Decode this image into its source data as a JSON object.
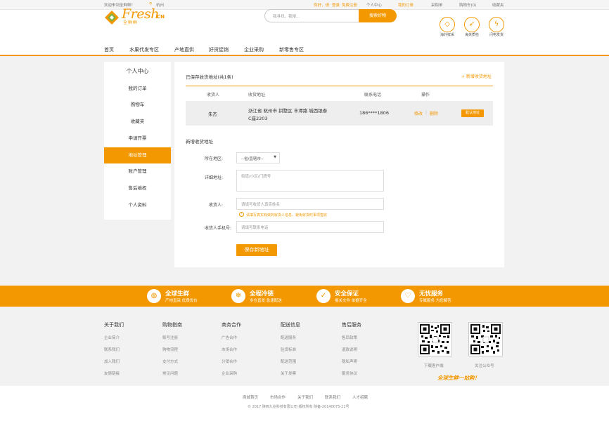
{
  "topbar": {
    "welcome": "欢迎来到全鲜鲜！",
    "city": "杭州",
    "greeting": "你好，请",
    "login": "登录",
    "register": "免费注册",
    "links": [
      "个人中心",
      "我的订单",
      "采购单",
      "购物车(0)",
      "收藏夹"
    ]
  },
  "header": {
    "logo_text": "Fresh",
    "logo_cn": "CN",
    "logo_sub": "全鲜鲜",
    "search_placeholder": "我寻找，我搜...",
    "search_button": "搜索好物",
    "icons": [
      {
        "label": "海外鲜采",
        "icon": "diamond-icon"
      },
      {
        "label": "海关质检",
        "icon": "rocket-icon"
      },
      {
        "label": "闪电发货",
        "icon": "lightning-icon"
      }
    ]
  },
  "nav": [
    "首页",
    "水果代发专区",
    "产地直供",
    "好货促销",
    "企业采购",
    "新零售专区"
  ],
  "sidebar": {
    "title": "个人中心",
    "items": [
      "我的订单",
      "购物车",
      "收藏夹",
      "申请开票",
      "地址管理",
      "账户管理",
      "售后维权",
      "个人资料"
    ],
    "active_index": 4
  },
  "address": {
    "saved_title": "已保存收货地址(共1条)",
    "add_link": "+ 新增收货地址",
    "columns": [
      "收货人",
      "收货地址",
      "联系电话",
      "操作"
    ],
    "rows": [
      {
        "name": "朱杰",
        "address_line1": "浙江省 杭州市 拱墅区 丰潭路 城西银泰",
        "address_line2": "C座2203",
        "phone": "186****1806",
        "edit": "修改",
        "delete": "删除",
        "default": "默认地址"
      }
    ]
  },
  "form": {
    "title": "新增收货地址",
    "region_label": "所在地区:",
    "region_value": "--省/直辖市--",
    "detail_label": "详细地址:",
    "detail_placeholder": "街道/小区/门牌号",
    "name_label": "收货人:",
    "name_placeholder": "请填写收货人真实姓名",
    "name_hint": "请填写真实有效的收货人信息，避免收货时事项签收",
    "phone_label": "收货人手机号:",
    "phone_placeholder": "请填写联系电话",
    "save_button": "保存新地址"
  },
  "banner": [
    {
      "title": "全球生鲜",
      "sub": "产地直采  优质优价",
      "icon": "globe-icon"
    },
    {
      "title": "全程冷链",
      "sub": "多仓直发  急速配送",
      "icon": "snowflake-icon"
    },
    {
      "title": "安全保证",
      "sub": "报关文件  单据齐全",
      "icon": "shield-check-icon"
    },
    {
      "title": "无忧服务",
      "sub": "专属服务  为您解答",
      "icon": "handshake-icon"
    }
  ],
  "footer": {
    "columns": [
      {
        "title": "关于我们",
        "items": [
          "企业简介",
          "联系我们",
          "加入我们",
          "友情链接"
        ]
      },
      {
        "title": "购物指南",
        "items": [
          "账号注册",
          "购物流程",
          "支付方式",
          "常见问题"
        ]
      },
      {
        "title": "商务合作",
        "items": [
          "广告合作",
          "市场合作",
          "分销合作",
          "企业采购"
        ]
      },
      {
        "title": "配送信息",
        "items": [
          "配送服务",
          "验货标准",
          "配送范围",
          "关于发票"
        ]
      },
      {
        "title": "售后服务",
        "items": [
          "售后政策",
          "退款说明",
          "隐私声明",
          "服务协议"
        ]
      }
    ],
    "qr": [
      {
        "label": "下载客户端"
      },
      {
        "label": "关注公众号"
      }
    ],
    "slogan": "全球生鲜一站购！",
    "bottom_links": [
      "商城首页",
      "市场合作",
      "关于我们",
      "联系我们",
      "人才招聘"
    ],
    "copyright": "© 2017 陕西九兆科技有限公司  版权所有  陕备-20140075-21号"
  },
  "colors": {
    "accent": "#f39800",
    "background": "#f2f2f2",
    "row_bg": "#eeeeee"
  }
}
